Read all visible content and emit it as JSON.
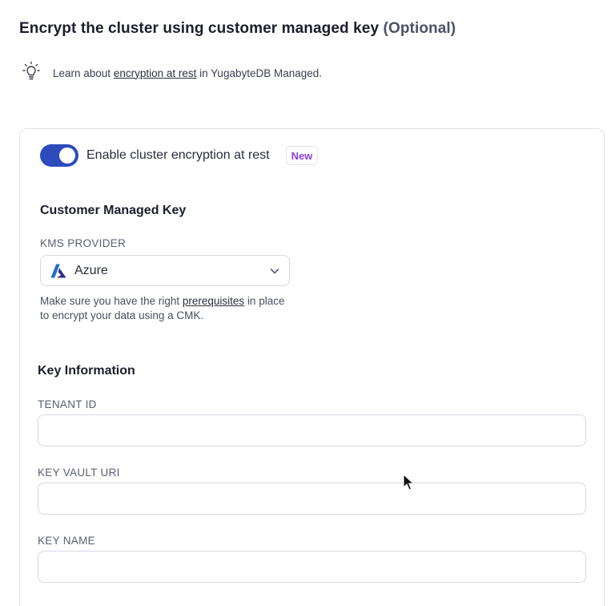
{
  "header": {
    "title": "Encrypt the cluster using customer managed key",
    "optional": "(Optional)"
  },
  "hint": {
    "icon": "lightbulb-icon",
    "prefix": "Learn about",
    "link": "encryption at rest",
    "suffix": "in YugabyteDB Managed."
  },
  "encryption": {
    "toggle_on": true,
    "toggle_label": "Enable cluster encryption at rest",
    "badge": "New",
    "accent_color": "#2d4bbd",
    "badge_color": "#8c3fe0"
  },
  "cmk": {
    "title": "Customer Managed Key",
    "kms_label": "KMS PROVIDER",
    "kms_selected": "Azure",
    "kms_icon": "azure-icon",
    "help_prefix": "Make sure you have the right",
    "help_link": "prerequisites",
    "help_suffix": "in place to encrypt your data using a CMK."
  },
  "key_info": {
    "title": "Key Information",
    "fields": [
      {
        "label": "TENANT ID",
        "value": ""
      },
      {
        "label": "KEY VAULT URI",
        "value": ""
      },
      {
        "label": "KEY NAME",
        "value": ""
      }
    ]
  }
}
